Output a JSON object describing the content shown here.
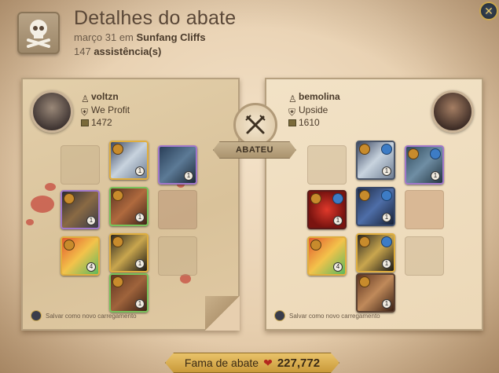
{
  "header": {
    "title": "Detalhes do abate",
    "date": "março 31",
    "in_word": "em",
    "location": "Sunfang Cliffs",
    "assist_count": "147",
    "assist_label": "assistência(s)"
  },
  "killer": {
    "name": "voltzn",
    "guild": "We Profit",
    "item_power": "1472"
  },
  "victim": {
    "name": "bemolina",
    "guild": "Upside",
    "item_power": "1610"
  },
  "center_label": "ABATEU",
  "save_loadout_label": "Salvar como novo carregamento",
  "fame": {
    "label": "Fama de abate",
    "value": "227,772"
  },
  "close_icon": "close-icon",
  "colors": {
    "green_frame": "#78c35b",
    "purple_frame": "#a077c9",
    "gold_frame": "#dfae3f",
    "fame_bar": "#d8ad52"
  }
}
